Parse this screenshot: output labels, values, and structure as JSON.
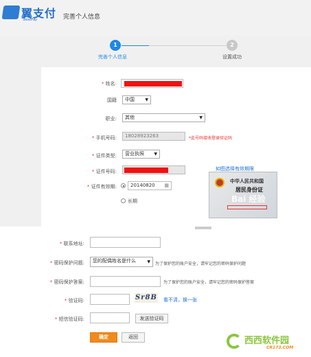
{
  "header": {
    "logo_text": "翼支付",
    "logo_sub": "BestPay",
    "page_title": "完善个人信息"
  },
  "steps": [
    {
      "number": "1",
      "label": "完善个人信息"
    },
    {
      "number": "2",
      "label": "设置成功"
    }
  ],
  "form": {
    "name_label": "姓名:",
    "nationality_label": "国籍",
    "nationality_value": "中国",
    "occupation_label": "职业:",
    "occupation_value": "其他",
    "phone_label": "手机号码:",
    "phone_value": "18028923263",
    "phone_hint": "*此号码接收登录验证码",
    "idtype_label": "证件类型:",
    "idtype_value": "营业执照",
    "idnum_label": "证件号码:",
    "idnum_hint_link": "如图选择有效期限",
    "validity_label": "证件有效期:",
    "validity_date": "20140820",
    "validity_long": "长期",
    "address_label": "联系地址:",
    "security_q_label": "密码保护问题:",
    "security_q_value": "您的配偶姓名是什么",
    "security_q_hint": "为了保护您的账户安全，请牢记您的密码保护问题",
    "security_a_label": "密码保护答案:",
    "security_a_hint": "为了保护您的账户安全，请牢记您的密码保护答案",
    "captcha_label": "验证码:",
    "captcha_text": "Sr8B",
    "captcha_refresh": "看不清，换一张",
    "sms_label": "短信验证码:",
    "sms_button": "发送验证码",
    "confirm_button": "确定",
    "back_button": "返回"
  },
  "idcard": {
    "title": "中华人民共和国",
    "subtitle": "居民身份证",
    "watermark": "Bai 经验"
  },
  "site_logo": {
    "text": "西西软件园",
    "sub": "CR173.COM"
  },
  "colors": {
    "brand_blue": "#1e88e5",
    "orange": "#f08a1c",
    "redact": "#f01010",
    "site_green": "#8bc53f"
  }
}
